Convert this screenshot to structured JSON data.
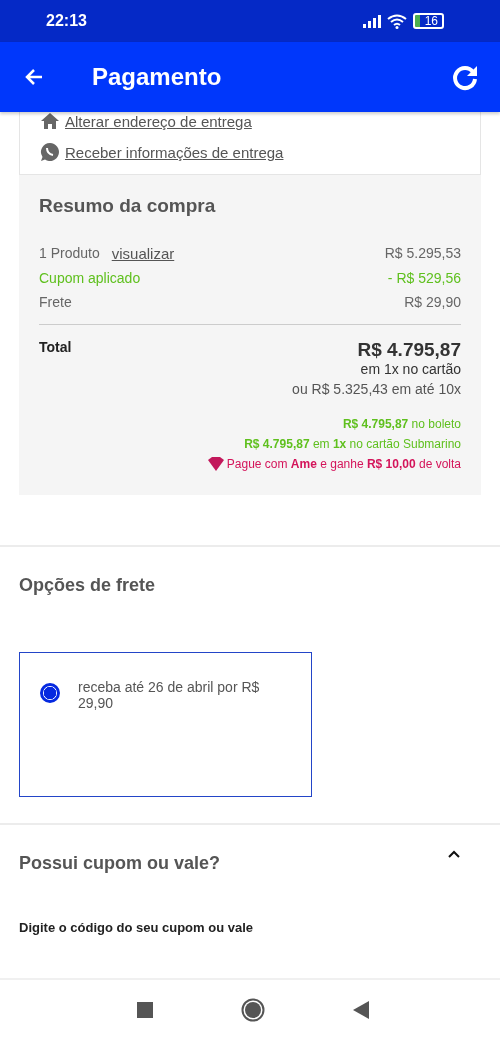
{
  "status_bar": {
    "time": "22:13",
    "battery": "16"
  },
  "app_bar": {
    "title": "Pagamento"
  },
  "delivery_links": [
    {
      "kind": "home",
      "label": "Alterar endereço de entrega"
    },
    {
      "kind": "chat",
      "label": "Receber informações de entrega"
    }
  ],
  "summary": {
    "title": "Resumo da compra",
    "rows": [
      {
        "kind": "product",
        "label": "1 Produto",
        "link": "visualizar",
        "value": "R$ 5.295,53"
      },
      {
        "kind": "discount",
        "label": "Cupom aplicado",
        "value": "- R$ 529,56"
      },
      {
        "kind": "plain",
        "label": "Frete",
        "value": "R$ 29,90"
      }
    ],
    "total_label": "Total",
    "total_value": "R$ 4.795,87",
    "total_note": "em 1x no cartão",
    "installments": "ou R$ 5.325,43 em até 10x",
    "offers": [
      {
        "kind": "green",
        "text": "**R$ 4.795,87** no boleto"
      },
      {
        "kind": "green",
        "text": "**R$ 4.795,87** em **1x** no cartão Submarino"
      },
      {
        "kind": "ame",
        "text": "Pague com **Ame** e ganhe **R$ 10,00** de volta"
      }
    ]
  },
  "shipping": {
    "title": "Opções de frete",
    "options": [
      {
        "label": "receba até 26 de abril por R$ 29,90",
        "selected": true
      }
    ]
  },
  "coupon": {
    "title": "Possui cupom ou vale?",
    "expanded": true,
    "field_label": "Digite o código do seu cupom ou vale"
  }
}
